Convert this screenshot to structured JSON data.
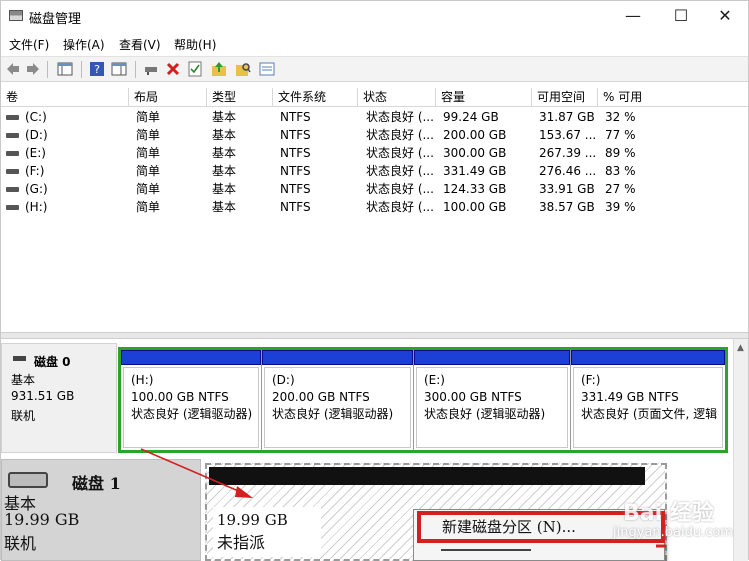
{
  "window": {
    "title": "磁盘管理"
  },
  "window_buttons": {
    "minimize": "—",
    "maximize": "☐",
    "close": "✕"
  },
  "menu": [
    "文件(F)",
    "操作(A)",
    "查看(V)",
    "帮助(H)"
  ],
  "table": {
    "columns": [
      "卷",
      "布局",
      "类型",
      "文件系统",
      "状态",
      "容量",
      "可用空间",
      "% 可用"
    ],
    "rows": [
      [
        "(C:)",
        "简单",
        "基本",
        "NTFS",
        "状态良好 (...",
        "99.24 GB",
        "31.87 GB",
        "32 %"
      ],
      [
        "(D:)",
        "简单",
        "基本",
        "NTFS",
        "状态良好 (...",
        "200.00 GB",
        "153.67 ...",
        "77 %"
      ],
      [
        "(E:)",
        "简单",
        "基本",
        "NTFS",
        "状态良好 (...",
        "300.00 GB",
        "267.39 ...",
        "89 %"
      ],
      [
        "(F:)",
        "简单",
        "基本",
        "NTFS",
        "状态良好 (...",
        "331.49 GB",
        "276.46 ...",
        "83 %"
      ],
      [
        "(G:)",
        "简单",
        "基本",
        "NTFS",
        "状态良好 (...",
        "124.33 GB",
        "33.91 GB",
        "27 %"
      ],
      [
        "(H:)",
        "简单",
        "基本",
        "NTFS",
        "状态良好 (...",
        "100.00 GB",
        "38.57 GB",
        "39 %"
      ]
    ]
  },
  "disk0": {
    "name": "磁盘 0",
    "type": "基本",
    "size": "931.51 GB",
    "status": "联机",
    "partitions": [
      {
        "letter": "(H:)",
        "size": "100.00 GB NTFS",
        "status": "状态良好 (逻辑驱动器)"
      },
      {
        "letter": "(D:)",
        "size": "200.00 GB NTFS",
        "status": "状态良好 (逻辑驱动器)"
      },
      {
        "letter": "(E:)",
        "size": "300.00 GB NTFS",
        "status": "状态良好 (逻辑驱动器)"
      },
      {
        "letter": "(F:)",
        "size": "331.49 GB NTFS",
        "status": "状态良好 (页面文件, 逻辑"
      }
    ]
  },
  "disk1": {
    "name": "磁盘 1",
    "type": "基本",
    "size": "19.99 GB",
    "status": "联机",
    "unallocated_size": "19.99 GB",
    "unallocated_label": "未指派"
  },
  "context_menu": {
    "item": "新建磁盘分区 (N)..."
  },
  "watermark": {
    "brand": "Bai 经验",
    "url": "jingyan.baidu.com"
  },
  "colors": {
    "partition_bar": "#1c3fd6",
    "disk_border": "#2aa52a",
    "highlight": "#d42020"
  }
}
